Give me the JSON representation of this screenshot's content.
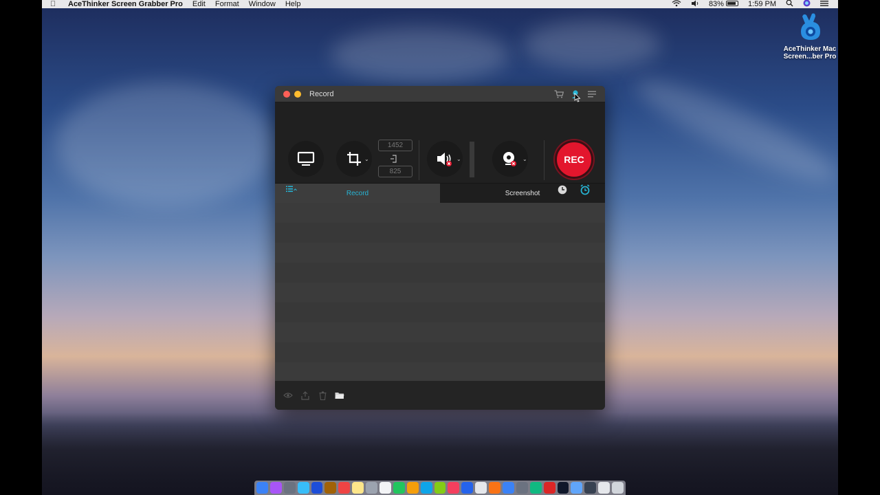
{
  "menubar": {
    "app_name": "AceThinker Screen Grabber Pro",
    "menus": [
      "Edit",
      "Format",
      "Window",
      "Help"
    ],
    "battery_pct": "83%",
    "time": "1:59 PM"
  },
  "desktop_icon": {
    "label_line1": "AceThinker Mac",
    "label_line2": "Screen...ber Pro"
  },
  "window": {
    "title": "Record",
    "width_value": "1452",
    "height_value": "825",
    "rec_label": "REC",
    "tabs": [
      {
        "label": "Record",
        "active": true
      },
      {
        "label": "Screenshot",
        "active": false
      }
    ]
  },
  "colors": {
    "accent": "#27b4d4",
    "rec_red": "#e3162d"
  },
  "dock_apps": [
    "#3b82f6",
    "#a855f7",
    "#6b7280",
    "#38bdf8",
    "#1d4ed8",
    "#a16207",
    "#ef4444",
    "#fde68a",
    "#9ca3af",
    "#f3f4f6",
    "#22c55e",
    "#f59e0b",
    "#0ea5e9",
    "#84cc16",
    "#f43f5e",
    "#2563eb",
    "#e5e7eb",
    "#f97316",
    "#3b82f6",
    "#6b7280",
    "#10b981",
    "#dc2626",
    "#0f172a",
    "#60a5fa",
    "#374151",
    "#e5e7eb",
    "#d1d5db"
  ]
}
